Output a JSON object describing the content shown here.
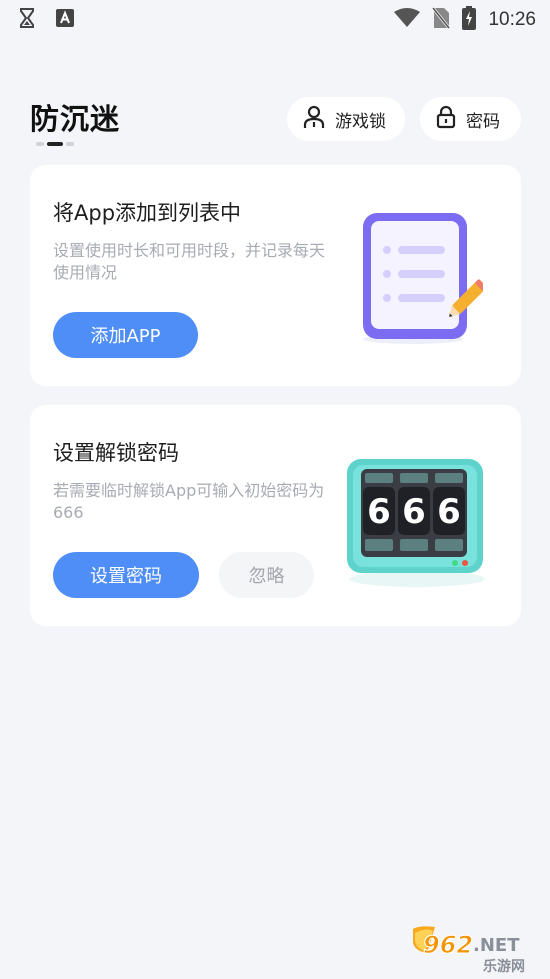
{
  "status_bar": {
    "time": "10:26",
    "icons": [
      "hourglass-icon",
      "a-badge-icon",
      "wifi-icon",
      "no-sim-icon",
      "battery-charging-icon"
    ]
  },
  "header": {
    "title": "防沉迷",
    "game_lock_label": "游戏锁",
    "password_label": "密码"
  },
  "cards": [
    {
      "title": "将App添加到列表中",
      "description": "设置使用时长和可用时段，并记录每天使用情况",
      "primary_button": "添加APP",
      "illustration": "notepad-pencil-icon"
    },
    {
      "title": "设置解锁密码",
      "description": "若需要临时解锁App可输入初始密码为666",
      "primary_button": "设置密码",
      "secondary_button": "忽略",
      "illustration": "code-lock-666-icon",
      "digits": [
        "6",
        "6",
        "6"
      ]
    }
  ],
  "watermark": {
    "line1": "962",
    "line1b": ".NET",
    "line2": "乐游网"
  },
  "colors": {
    "accent": "#4f8ef7",
    "background": "#f4f5f9",
    "card": "#ffffff",
    "muted_text": "#a8abb3",
    "notepad_purple": "#7b6cf2",
    "lock_teal": "#5dd3cc"
  }
}
